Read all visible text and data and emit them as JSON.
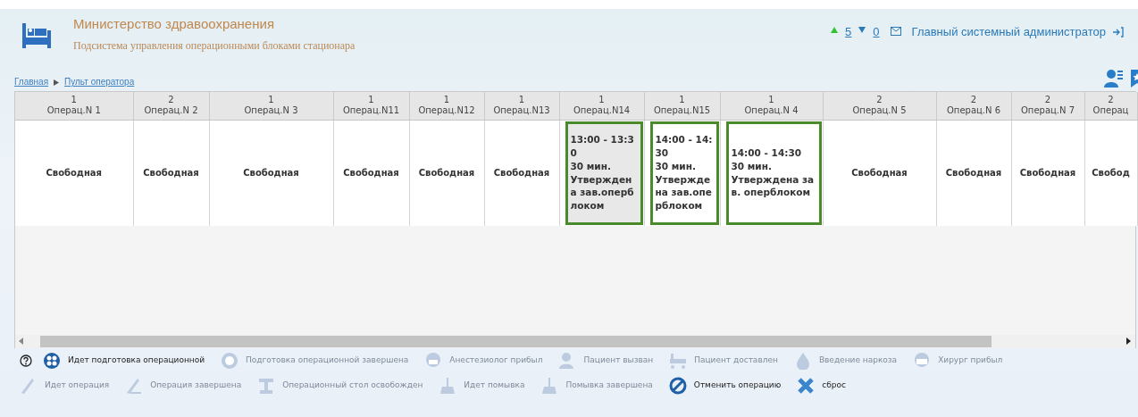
{
  "header": {
    "title": "Министерство здравоохранения",
    "subtitle": "Подсистема управления операционными блоками стационара",
    "counter_up": "5",
    "counter_down": "0",
    "user": "Главный системный администратор"
  },
  "breadcrumb": [
    {
      "label": "Главная"
    },
    {
      "label": "Пульт оператора"
    }
  ],
  "table": {
    "columns": [
      {
        "floor": "1",
        "name": "Операц.N 1"
      },
      {
        "floor": "2",
        "name": "Операц.N 2"
      },
      {
        "floor": "1",
        "name": "Операц.N 3"
      },
      {
        "floor": "1",
        "name": "Операц.N11"
      },
      {
        "floor": "1",
        "name": "Операц.N12"
      },
      {
        "floor": "1",
        "name": "Операц.N13"
      },
      {
        "floor": "1",
        "name": "Операц.N14"
      },
      {
        "floor": "1",
        "name": "Операц.N15"
      },
      {
        "floor": "1",
        "name": "Операц.N 4"
      },
      {
        "floor": "2",
        "name": "Операц.N 5"
      },
      {
        "floor": "2",
        "name": "Операц.N 6"
      },
      {
        "floor": "2",
        "name": "Операц.N 7"
      },
      {
        "floor": "2",
        "name": "Операц"
      }
    ],
    "cells": [
      {
        "kind": "free",
        "text": "Свободная",
        "selected": false
      },
      {
        "kind": "free",
        "text": "Свободная",
        "selected": false
      },
      {
        "kind": "free",
        "text": "Свободная",
        "selected": false
      },
      {
        "kind": "free",
        "text": "Свободная",
        "selected": false
      },
      {
        "kind": "free",
        "text": "Свободная",
        "selected": false
      },
      {
        "kind": "free",
        "text": "Свободная",
        "selected": false
      },
      {
        "kind": "booked",
        "lines": [
          "13:00 - 13:30",
          "30 мин.",
          "Утверждена зав.оперблоком"
        ],
        "selected": true
      },
      {
        "kind": "booked",
        "lines": [
          "14:00 - 14:30",
          "30 мин.",
          "Утверждена зав.оперблоком"
        ],
        "selected": false
      },
      {
        "kind": "booked",
        "lines": [
          "14:00 - 14:30",
          "30 мин.",
          "Утверждена зав. оперблоком"
        ],
        "selected": false
      },
      {
        "kind": "free",
        "text": "Свободная",
        "selected": false
      },
      {
        "kind": "free",
        "text": "Свободная",
        "selected": false
      },
      {
        "kind": "free",
        "text": "Свободная",
        "selected": false
      },
      {
        "kind": "free",
        "text": "Свобод",
        "selected": false
      }
    ]
  },
  "actions": [
    [
      {
        "label": "Идет подготовка операционной",
        "disabled": false
      },
      {
        "label": "Подготовка операционной завершена",
        "disabled": true
      },
      {
        "label": "Анестезиолог прибыл",
        "disabled": true
      },
      {
        "label": "Пациент вызван",
        "disabled": true
      },
      {
        "label": "Пациент доставлен",
        "disabled": true
      },
      {
        "label": "Введение наркоза",
        "disabled": true
      },
      {
        "label": "Хирург прибыл",
        "disabled": true
      }
    ],
    [
      {
        "label": "Идет операция",
        "disabled": true
      },
      {
        "label": "Операция завершена",
        "disabled": true
      },
      {
        "label": "Операционный стол освобожден",
        "disabled": true
      },
      {
        "label": "Идет помывка",
        "disabled": true
      },
      {
        "label": "Помывка завершена",
        "disabled": true
      },
      {
        "label": "Отменить операцию",
        "disabled": false
      },
      {
        "label": "сброс",
        "disabled": false
      }
    ]
  ]
}
